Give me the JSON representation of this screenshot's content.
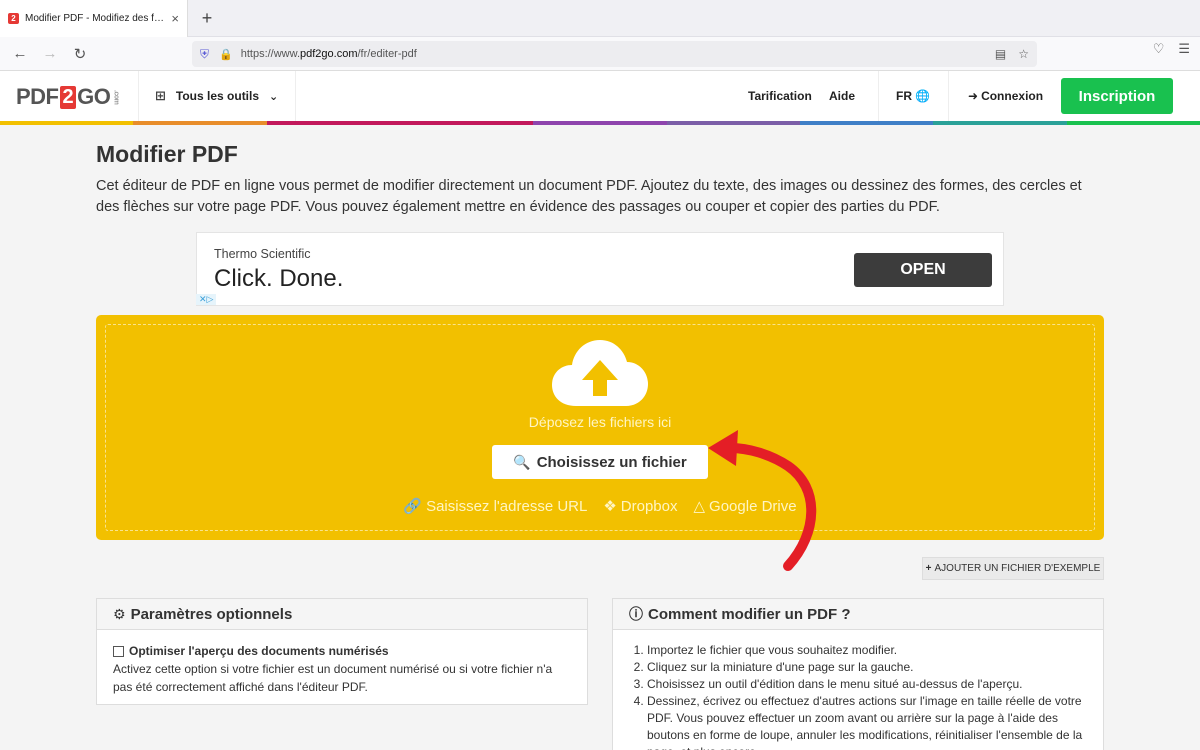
{
  "browser": {
    "tab_title": "Modifier PDF - Modifiez des fichiers PDF en ligne",
    "tab_close": "×",
    "new_tab": "+",
    "url_prefix": "https://www.",
    "url_domain": "pdf2go.com",
    "url_path": "/fr/editer-pdf"
  },
  "header": {
    "logo_pdf": "PDF",
    "logo_two": "2",
    "logo_go": "GO",
    "logo_com": ".com",
    "tools_label": "Tous les outils",
    "pricing": "Tarification",
    "help": "Aide",
    "language": "FR",
    "login": "Connexion",
    "signup": "Inscription",
    "rainbow_colors": [
      "#f2c000",
      "#e88d2a",
      "#c2185b",
      "#c2185b",
      "#8e44ad",
      "#7b5ea7",
      "#3f7fc7",
      "#2aa198",
      "#19c14f"
    ]
  },
  "main": {
    "title": "Modifier PDF",
    "intro": "Cet éditeur de PDF en ligne vous permet de modifier directement un document PDF. Ajoutez du texte, des images ou dessinez des formes, des cercles et des flèches sur votre page PDF. Vous pouvez également mettre en évidence des passages ou couper et copier des parties du PDF."
  },
  "ad": {
    "brand": "Thermo Scientific",
    "headline": "Click. Done.",
    "button": "OPEN"
  },
  "dropzone": {
    "drop_text": "Déposez les fichiers ici",
    "choose_button": "Choisissez un fichier",
    "url_source": "Saisissez l'adresse URL",
    "dropbox_source": "Dropbox",
    "gdrive_source": "Google Drive",
    "accent_color": "#f2c000"
  },
  "sample_button": "AJOUTER UN FICHIER D'EXEMPLE",
  "options_panel": {
    "title": "Paramètres optionnels",
    "checkbox_label": "Optimiser l'aperçu des documents numérisés",
    "checkbox_checked": false,
    "description": "Activez cette option si votre fichier est un document numérisé ou si votre fichier n'a pas été correctement affiché dans l'éditeur PDF."
  },
  "help_panel": {
    "title": "Comment modifier un PDF ?",
    "steps": [
      "Importez le fichier que vous souhaitez modifier.",
      "Cliquez sur la miniature d'une page sur la gauche.",
      "Choisissez un outil d'édition dans le menu situé au-dessus de l'aperçu.",
      "Dessinez, écrivez ou effectuez d'autres actions sur l'image en taille réelle de votre PDF. Vous pouvez effectuer un zoom avant ou arrière sur la page à l'aide des boutons en forme de loupe, annuler les modifications, réinitialiser l'ensemble de la page, et plus encore."
    ]
  }
}
